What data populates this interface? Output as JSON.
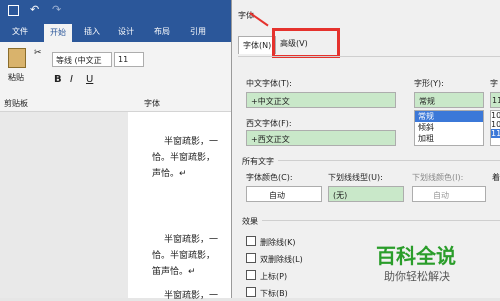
{
  "app": {
    "tabs": [
      "文件",
      "开始",
      "插入",
      "设计",
      "布局",
      "引用"
    ],
    "active_tab": "开始"
  },
  "ribbon": {
    "paste": "粘贴",
    "clipboard": "剪贴板",
    "font_name": "等线 (中文正",
    "font_size": "11",
    "font_group": "字体"
  },
  "doc": {
    "lines": [
      "半窗疏影，一",
      "恰。半窗疏影，",
      "声恰。↵",
      "半窗疏影，一",
      "恰。半窗疏影，",
      "笛声恰。↵",
      "半窗疏影，一"
    ]
  },
  "dialog": {
    "title": "字体",
    "tabs": [
      "字体(N)",
      "高级(V)"
    ],
    "cn_font_label": "中文字体(T):",
    "cn_font_value": "+中文正文",
    "style_label": "字形(Y):",
    "style_value": "常规",
    "style_options": [
      "常规",
      "倾斜",
      "加粗"
    ],
    "size_label": "字",
    "size_value": "11",
    "size_options": [
      "10",
      "10",
      "11"
    ],
    "west_font_label": "西文字体(F):",
    "west_font_value": "+西文正文",
    "all_text": "所有文字",
    "color_label": "字体颜色(C):",
    "color_value": "自动",
    "underline_label": "下划线线型(U):",
    "underline_value": "(无)",
    "ucolor_label": "下划线颜色(I):",
    "ucolor_value": "自动",
    "emph_label": "着",
    "effects": "效果",
    "effects_items": [
      "删除线(K)",
      "双删除线(L)",
      "上标(P)",
      "下标(B)"
    ]
  },
  "watermark": {
    "big": "百科全说",
    "small": "助你轻松解决"
  }
}
